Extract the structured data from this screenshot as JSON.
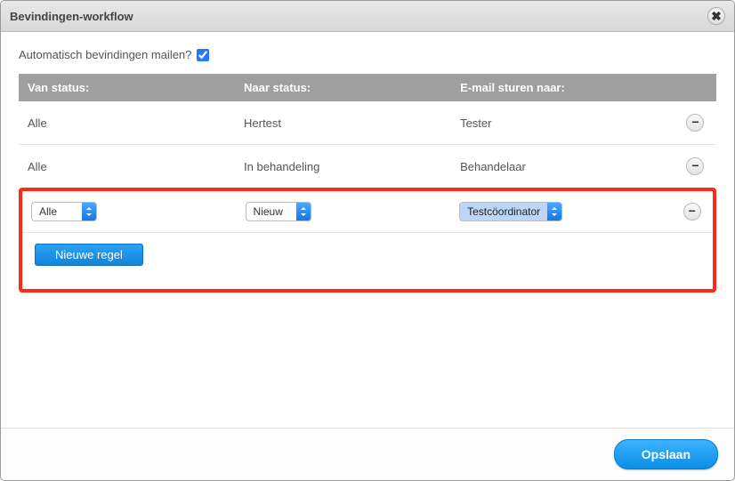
{
  "dialog": {
    "title": "Bevindingen-workflow"
  },
  "autoMail": {
    "label": "Automatisch bevindingen mailen?",
    "checked": true
  },
  "table": {
    "headers": {
      "from": "Van status:",
      "to": "Naar status:",
      "mail": "E-mail sturen naar:"
    },
    "rows": [
      {
        "from": "Alle",
        "to": "Hertest",
        "mail": "Tester"
      },
      {
        "from": "Alle",
        "to": "In behandeling",
        "mail": "Behandelaar"
      }
    ],
    "editRow": {
      "from": "Alle",
      "to": "Nieuw",
      "mail": "Testcöordinator"
    }
  },
  "buttons": {
    "newRule": "Nieuwe regel",
    "save": "Opslaan"
  }
}
